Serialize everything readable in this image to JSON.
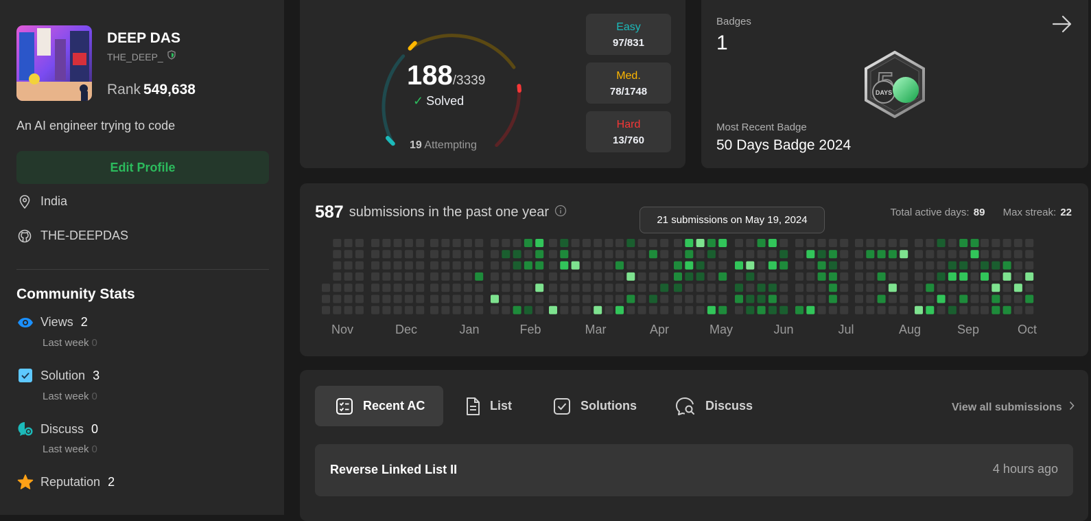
{
  "profile": {
    "name": "DEEP DAS",
    "username": "THE_DEEP_",
    "rank_label": "Rank",
    "rank_value": "549,638",
    "bio": "An AI engineer trying to code",
    "edit_button": "Edit Profile",
    "location": "India",
    "github": "THE-DEEPDAS"
  },
  "community_stats": {
    "title": "Community Stats",
    "items": [
      {
        "label": "Views",
        "value": "2",
        "last_week_label": "Last week",
        "last_week_value": "0",
        "icon": "eye-icon"
      },
      {
        "label": "Solution",
        "value": "3",
        "last_week_label": "Last week",
        "last_week_value": "0",
        "icon": "checkbox-icon"
      },
      {
        "label": "Discuss",
        "value": "0",
        "last_week_label": "Last week",
        "last_week_value": "0",
        "icon": "discuss-icon"
      },
      {
        "label": "Reputation",
        "value": "2",
        "icon": "star-icon"
      }
    ]
  },
  "solved": {
    "count": "188",
    "total": "/3339",
    "label": "Solved",
    "attempting_count": "19",
    "attempting_label": "Attempting",
    "difficulties": [
      {
        "label": "Easy",
        "value": "97/831",
        "color": "#1cbaba"
      },
      {
        "label": "Med.",
        "value": "78/1748",
        "color": "#ffb700"
      },
      {
        "label": "Hard",
        "value": "13/760",
        "color": "#f63737"
      }
    ]
  },
  "badges": {
    "label": "Badges",
    "count": "1",
    "badge_text": "DAYS",
    "recent_label": "Most Recent Badge",
    "recent_name": "50 Days Badge 2024"
  },
  "heatmap": {
    "count": "587",
    "title": "submissions in the past one year",
    "active_days_label": "Total active days:",
    "active_days": "89",
    "max_streak_label": "Max streak:",
    "max_streak": "22",
    "tooltip": "21 submissions on May 19, 2024",
    "months": [
      "Nov",
      "Dec",
      "Jan",
      "Feb",
      "Mar",
      "Apr",
      "May",
      "Jun",
      "Jul",
      "Aug",
      "Sep",
      "Oct"
    ]
  },
  "recent": {
    "tabs": [
      {
        "label": "Recent AC",
        "icon": "checklist-icon",
        "active": true
      },
      {
        "label": "List",
        "icon": "document-icon",
        "active": false
      },
      {
        "label": "Solutions",
        "icon": "checkbox-outline-icon",
        "active": false
      },
      {
        "label": "Discuss",
        "icon": "chat-search-icon",
        "active": false
      }
    ],
    "view_all": "View all submissions",
    "items": [
      {
        "title": "Reverse Linked List II",
        "time": "4 hours ago"
      }
    ]
  },
  "colors": {
    "accent_green": "#2cbb5d",
    "easy": "#1cbaba",
    "medium": "#ffb700",
    "hard": "#f63737"
  }
}
